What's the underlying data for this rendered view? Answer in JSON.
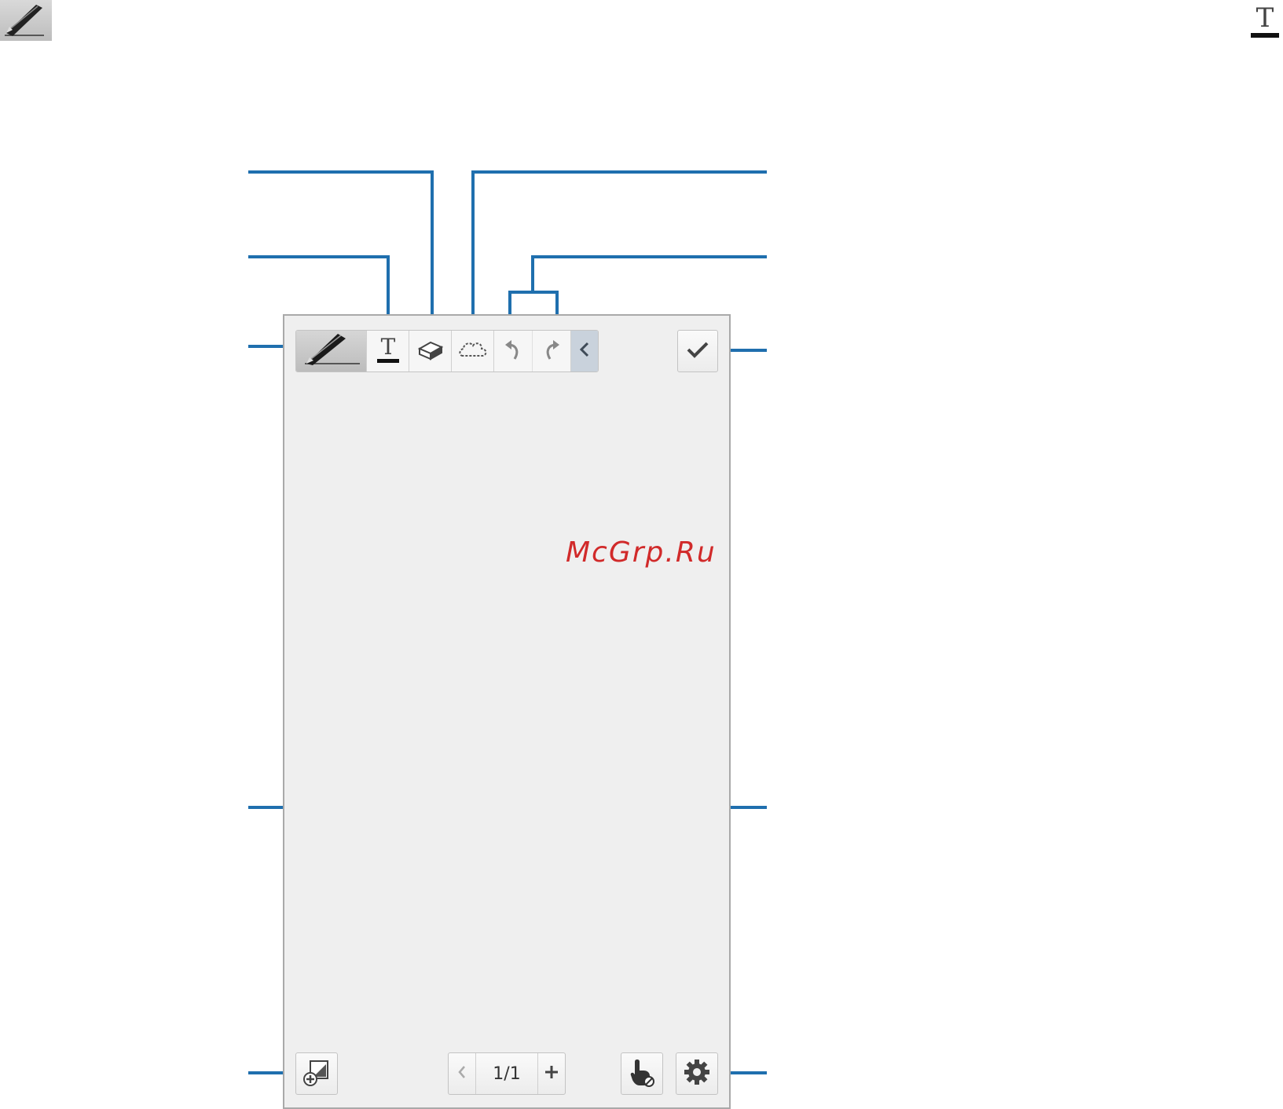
{
  "corner_icons": {
    "left": "pen-icon",
    "right": "text-icon"
  },
  "toolbar": {
    "tools": [
      {
        "name": "pen",
        "icon": "pen-icon",
        "selected": true
      },
      {
        "name": "text",
        "icon": "text-icon"
      },
      {
        "name": "eraser",
        "icon": "eraser-icon"
      },
      {
        "name": "selection",
        "icon": "lasso-select-icon"
      },
      {
        "name": "undo",
        "icon": "undo-icon"
      },
      {
        "name": "redo",
        "icon": "redo-icon"
      },
      {
        "name": "collapse",
        "icon": "chevron-left-icon"
      }
    ],
    "done_icon": "checkmark-icon"
  },
  "bottom_bar": {
    "insert_page_icon": "add-image-icon",
    "page_indicator": "1/1",
    "prev_icon": "chevron-left-icon",
    "add_page_icon": "plus-icon",
    "hand_mode_icon": "hand-pointer-icon",
    "settings_icon": "gear-icon"
  },
  "watermark": "McGrp.Ru",
  "colors": {
    "callout": "#1f6fae",
    "screen_bg": "#efefef",
    "collapse_bg": "#c9d2dc",
    "watermark": "#d12a2a"
  }
}
